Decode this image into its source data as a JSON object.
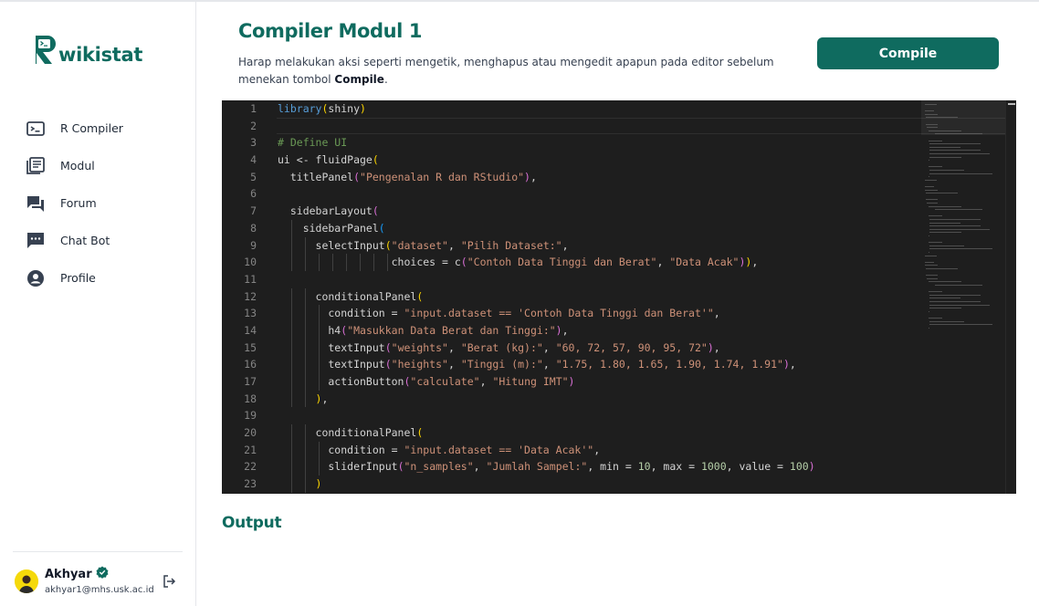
{
  "app": {
    "logo_letter": "R",
    "logo_text": "wikistat"
  },
  "sidebar": {
    "items": [
      {
        "label": "R Compiler",
        "icon": "terminal-icon"
      },
      {
        "label": "Modul",
        "icon": "library-books-icon"
      },
      {
        "label": "Forum",
        "icon": "forum-icon"
      },
      {
        "label": "Chat Bot",
        "icon": "chat-bubble-icon"
      },
      {
        "label": "Profile",
        "icon": "account-circle-icon"
      }
    ]
  },
  "user": {
    "name": "Akhyar",
    "email": "akhyar1@mhs.usk.ac.id",
    "verified_icon": "verified-badge-icon",
    "logout_icon": "logout-icon"
  },
  "main": {
    "title": "Compiler Modul 1",
    "description_prefix": "Harap melakukan aksi seperti mengetik, menghapus atau mengedit apapun pada editor sebelum menekan tombol ",
    "description_bold": "Compile",
    "description_suffix": ".",
    "compile_label": "Compile",
    "output_title": "Output"
  },
  "colors": {
    "brand": "#0f6b5f",
    "editor_bg": "#1e1e1e"
  },
  "editor": {
    "lines": [
      "library(shiny)",
      "",
      "# Define UI",
      "ui <- fluidPage(",
      "  titlePanel(\"Pengenalan R dan RStudio\"),",
      "",
      "  sidebarLayout(",
      "    sidebarPanel(",
      "      selectInput(\"dataset\", \"Pilih Dataset:\",",
      "                  choices = c(\"Contoh Data Tinggi dan Berat\", \"Data Acak\")),",
      "",
      "      conditionalPanel(",
      "        condition = \"input.dataset == 'Contoh Data Tinggi dan Berat'\",",
      "        h4(\"Masukkan Data Berat dan Tinggi:\"),",
      "        textInput(\"weights\", \"Berat (kg):\", \"60, 72, 57, 90, 95, 72\"),",
      "        textInput(\"heights\", \"Tinggi (m):\", \"1.75, 1.80, 1.65, 1.90, 1.74, 1.91\"),",
      "        actionButton(\"calculate\", \"Hitung IMT\")",
      "      ),",
      "",
      "      conditionalPanel(",
      "        condition = \"input.dataset == 'Data Acak'\",",
      "        sliderInput(\"n_samples\", \"Jumlah Sampel:\", min = 10, max = 1000, value = 100)",
      "      )"
    ]
  }
}
